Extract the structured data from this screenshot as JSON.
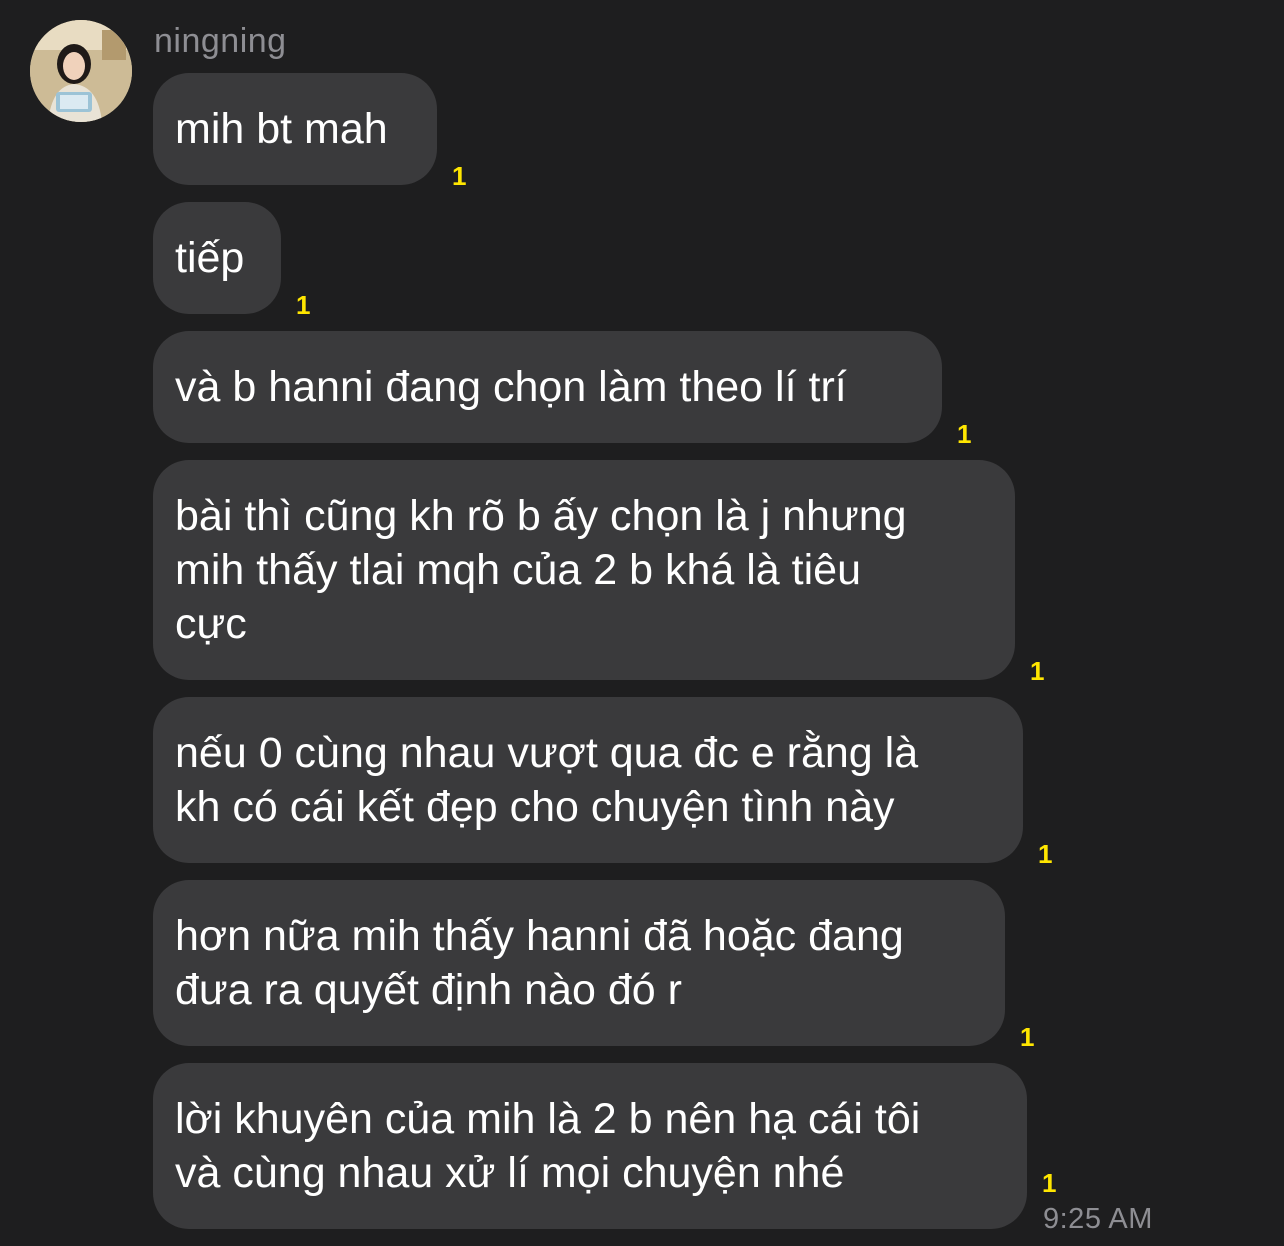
{
  "chat": {
    "sender_name": "ningning",
    "avatar_icon": "profile-photo",
    "unread_color": "#ffe600",
    "bubble_color": "#3a3a3c",
    "messages": [
      {
        "text": "mih bt mah",
        "unread": "1"
      },
      {
        "text": "tiếp",
        "unread": "1"
      },
      {
        "text": "và b hanni đang chọn làm theo lí trí",
        "unread": "1"
      },
      {
        "text": "bài thì cũng kh rõ b ấy chọn là j nhưng\nmih thấy tlai mqh của 2 b khá là tiêu\ncực",
        "unread": "1"
      },
      {
        "text": "nếu 0 cùng nhau vượt qua đc e rằng là\nkh có cái kết đẹp cho chuyện tình này",
        "unread": "1"
      },
      {
        "text": "hơn nữa mih thấy hanni đã hoặc đang\nđưa ra quyết định nào đó r",
        "unread": "1"
      },
      {
        "text": "lời khuyên của mih là 2 b nên hạ cái tôi\nvà cùng nhau xử lí mọi chuyện nhé",
        "unread": "1"
      }
    ],
    "timestamp": "9:25 AM"
  }
}
